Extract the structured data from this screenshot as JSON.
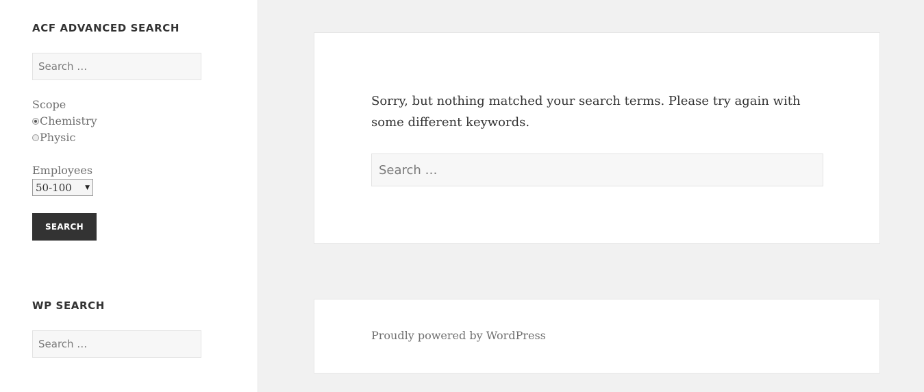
{
  "sidebar": {
    "acf_widget": {
      "title": "ACF ADVANCED SEARCH",
      "search_placeholder": "Search …",
      "scope": {
        "label": "Scope",
        "options": [
          {
            "label": "Chemistry",
            "checked": true
          },
          {
            "label": "Physic",
            "checked": false
          }
        ]
      },
      "employees": {
        "label": "Employees",
        "selected": "50-100"
      },
      "submit_label": "SEARCH"
    },
    "wp_widget": {
      "title": "WP SEARCH",
      "search_placeholder": "Search …"
    }
  },
  "main": {
    "no_results_message": "Sorry, but nothing matched your search terms. Please try again with some different keywords.",
    "search_placeholder": "Search …"
  },
  "footer": {
    "credit": "Proudly powered by WordPress"
  },
  "colors": {
    "page_background": "#f1f1f1",
    "panel_background": "#ffffff",
    "button_background": "#333333"
  }
}
